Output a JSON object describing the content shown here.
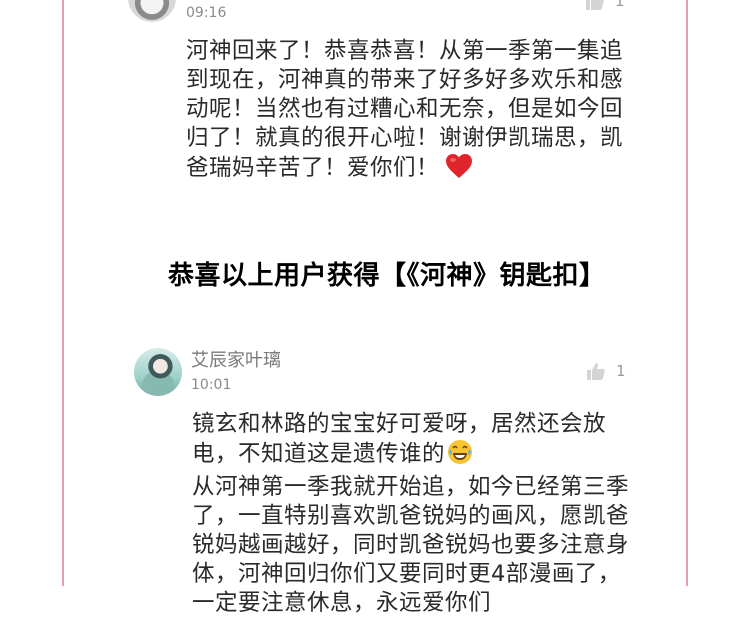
{
  "comment1": {
    "time": "09:16",
    "likes": "1",
    "text": "河神回来了！恭喜恭喜！从第一季第一集追到现在，河神真的带来了好多好多欢乐和感动呢！当然也有过糟心和无奈，但是如今回归了！就真的很开心啦！谢谢伊凯瑞思，凯爸瑞妈辛苦了！爱你们！",
    "emoji": "heart-icon"
  },
  "announcement": "恭喜以上用户获得【《河神》钥匙扣】",
  "comment2": {
    "username": "艾辰家叶璃",
    "time": "10:01",
    "likes": "1",
    "text_part1": "镜玄和林路的宝宝好可爱呀，居然还会放电，不知道这是遗传谁的",
    "emoji": "laughing-tears-icon",
    "text_part2": "从河神第一季我就开始追，如今已经第三季了，一直特别喜欢凯爸锐妈的画风，愿凯爸锐妈越画越好，同时凯爸锐妈也要多注意身体，河神回归你们又要同时更4部漫画了，一定要注意休息，永远爱你们"
  },
  "colors": {
    "frame": "#e3a0b4",
    "heart": "#e0242c",
    "text": "#2a2a2a",
    "meta": "#8a8a8a"
  }
}
